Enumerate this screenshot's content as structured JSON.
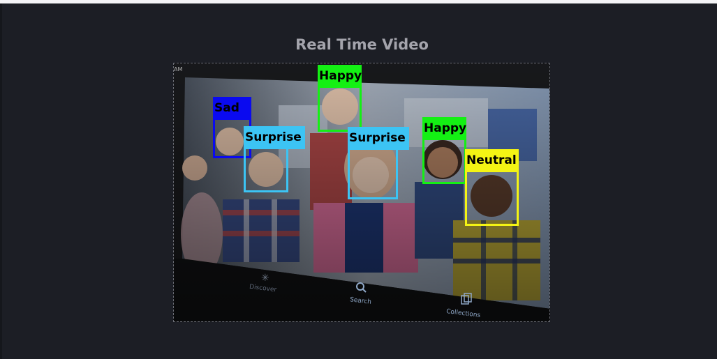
{
  "page": {
    "title": "Real Time Video"
  },
  "video": {
    "status_text": "AM",
    "nav": {
      "discover": "Discover",
      "search": "Search",
      "collections": "Collections"
    },
    "detections": [
      {
        "label": "Sad",
        "color": "#0a0af0"
      },
      {
        "label": "Surprise",
        "color": "#3cc4f4"
      },
      {
        "label": "Happy",
        "color": "#14f014"
      },
      {
        "label": "Surprise",
        "color": "#3cc4f4"
      },
      {
        "label": "Happy",
        "color": "#14f014"
      },
      {
        "label": "Neutral",
        "color": "#f4f414"
      }
    ]
  }
}
